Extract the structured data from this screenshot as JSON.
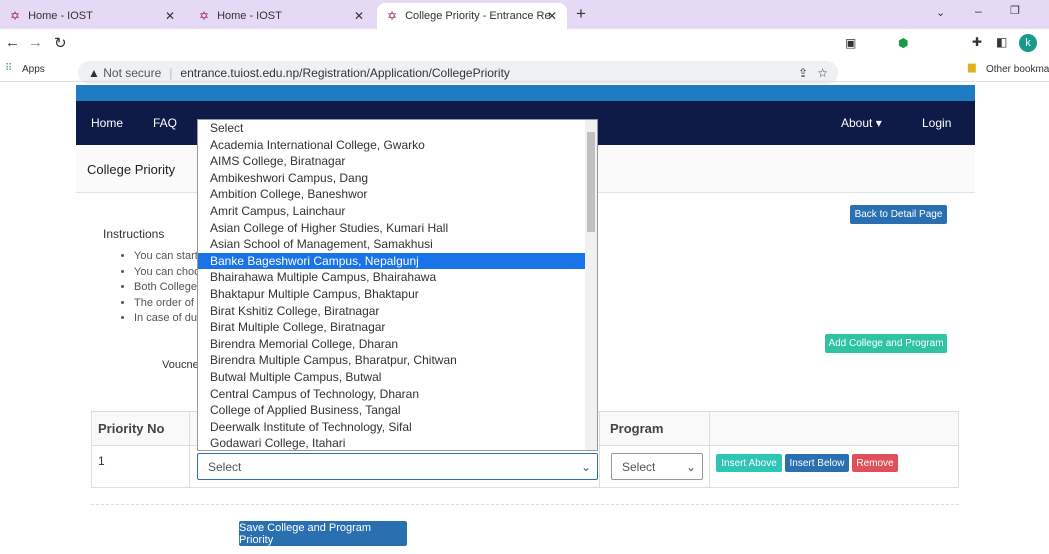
{
  "browser": {
    "tabs": [
      {
        "title": "Home - IOST"
      },
      {
        "title": "Home - IOST"
      },
      {
        "title": "College Priority - Entrance Regist"
      }
    ],
    "security": "Not secure",
    "url": "entrance.tuiost.edu.np/Registration/Application/CollegePriority",
    "bookmarks": {
      "apps": "Apps",
      "other": "Other bookmarks"
    },
    "profile_initial": "k"
  },
  "nav": {
    "home": "Home",
    "faq": "FAQ",
    "about": "About ▾",
    "login": "Login"
  },
  "page": {
    "title": "College Priority",
    "back_button": "Back to Detail Page",
    "instructions_title": "Instructions",
    "instructions": [
      "You can start",
      "You can choo",
      "Both College",
      "The order of",
      "In case of du"
    ],
    "add_button": "Add College and Program",
    "voucher_label": "Voucne",
    "table": {
      "headers": [
        "Priority No",
        "",
        "Program",
        ""
      ],
      "rows": [
        {
          "priority": "1",
          "college": "Select",
          "program": "Select"
        }
      ]
    },
    "row_buttons": {
      "insert_above": "Insert Above",
      "insert_below": "Insert Below",
      "remove": "Remove"
    },
    "save_button": "Save College and Program Priority"
  },
  "dropdown": {
    "selected": "Banke Bageshwori Campus, Nepalgunj",
    "options": [
      "Select",
      "Academia International College, Gwarko",
      "AIMS College, Biratnagar",
      "Ambikeshwori Campus, Dang",
      "Ambition College, Baneshwor",
      "Amrit Campus, Lainchaur",
      "Asian College of Higher Studies, Kumari Hall",
      "Asian School of Management, Samakhusi",
      "Banke Bageshwori Campus, Nepalgunj",
      "Bhairahawa Multiple Campus, Bhairahawa",
      "Bhaktapur Multiple Campus, Bhaktapur",
      "Birat Kshitiz College, Biratnagar",
      "Birat Multiple College, Biratnagar",
      "Birendra Memorial College, Dharan",
      "Birendra Multiple Campus, Bharatpur, Chitwan",
      "Butwal Multiple Campus, Butwal",
      "Central Campus of Technology, Dharan",
      "College of Applied Business, Tangal",
      "Deerwalk Institute of Technology, Sifal",
      "Godawari College, Itahari"
    ]
  },
  "colors": {
    "nav": "#0e1a47",
    "band": "#1f7cc2",
    "teal": "#2ec4b6",
    "blue": "#2a6fb0",
    "red": "#e0505a",
    "highlight": "#1a73e8"
  }
}
